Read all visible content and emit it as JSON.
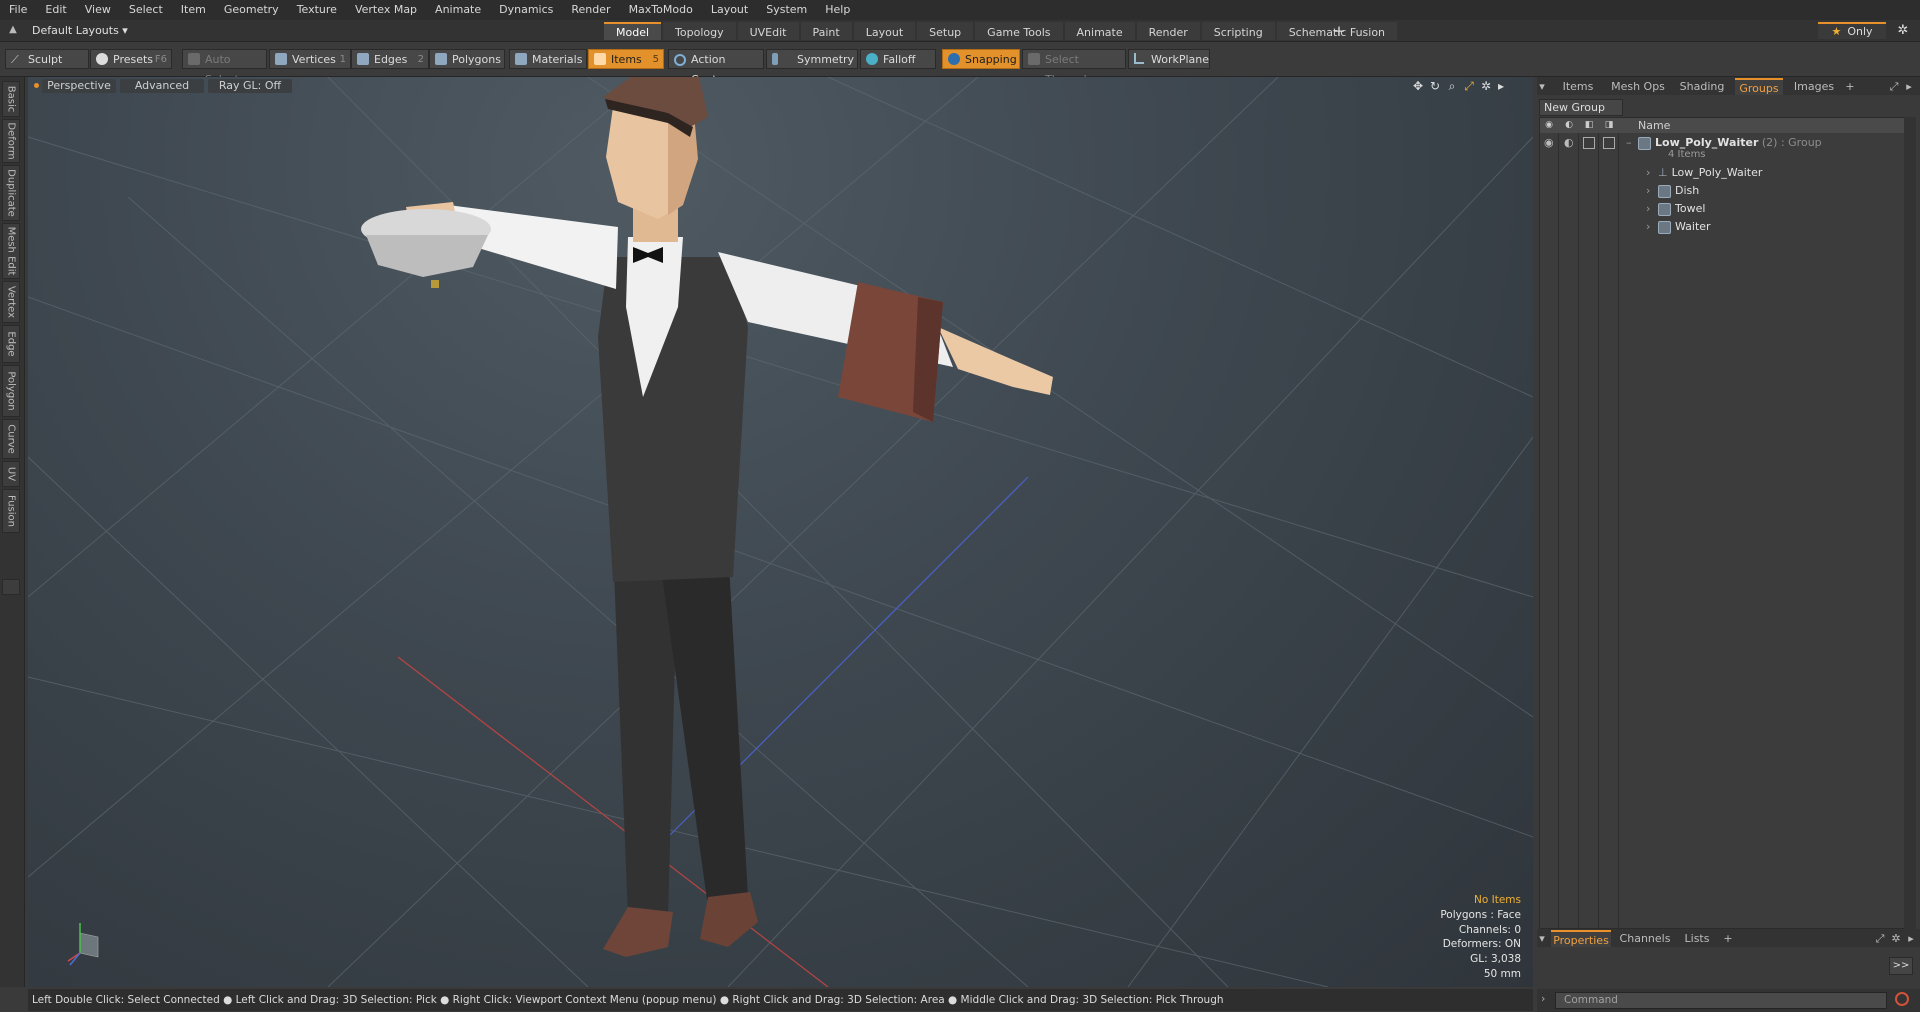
{
  "menu": [
    "File",
    "Edit",
    "View",
    "Select",
    "Item",
    "Geometry",
    "Texture",
    "Vertex Map",
    "Animate",
    "Dynamics",
    "Render",
    "MaxToModo",
    "Layout",
    "System",
    "Help"
  ],
  "layout_selector": "Default Layouts ▾",
  "mode_tabs": [
    "Model",
    "Topology",
    "UVEdit",
    "Paint",
    "Layout",
    "Setup",
    "Game Tools",
    "Animate",
    "Render",
    "Scripting",
    "Schematic Fusion"
  ],
  "active_mode_tab": "Model",
  "add_tab": "+",
  "only_label": "Only",
  "toolbar": {
    "sculpt": "Sculpt",
    "presets": "Presets",
    "presets_key": "F6",
    "auto_select": "Auto Select",
    "vertices": "Vertices",
    "vertices_key": "1",
    "edges": "Edges",
    "edges_key": "2",
    "polygons": "Polygons",
    "materials": "Materials",
    "items": "Items",
    "items_key": "5",
    "action_center": "Action Center",
    "symmetry": "Symmetry",
    "falloff": "Falloff",
    "snapping": "Snapping",
    "select_through": "Select Through",
    "workplane": "WorkPlane"
  },
  "left_tabs": [
    "Basic",
    "Deform",
    "Duplicate",
    "Mesh Edit",
    "Vertex",
    "Edge",
    "Polygon",
    "Curve",
    "UV",
    "Fusion"
  ],
  "viewport": {
    "view_type": "Perspective",
    "shading": "Advanced",
    "raygl": "Ray GL: Off"
  },
  "stats": [
    "No Items",
    "Polygons : Face",
    "Channels: 0",
    "Deformers: ON",
    "GL: 3,038",
    "50 mm"
  ],
  "status_bar": "Left Double Click: Select Connected ● Left Click and Drag: 3D Selection: Pick ● Right Click: Viewport Context Menu (popup menu) ● Right Click and Drag: 3D Selection: Area ● Middle Click and Drag: 3D Selection: Pick Through",
  "right_tabs": [
    "Items",
    "Mesh Ops",
    "Shading",
    "Groups",
    "Images",
    "+"
  ],
  "active_right_tab": "Groups",
  "new_group": "New Group",
  "tree": {
    "name_header": "Name",
    "group_name": "Low_Poly_Waiter",
    "group_suffix": "(2) : Group",
    "group_count": "4 Items",
    "children": [
      "Low_Poly_Waiter",
      "Dish",
      "Towel",
      "Waiter"
    ]
  },
  "bottom_tabs": [
    "Properties",
    "Channels",
    "Lists",
    "+"
  ],
  "active_bottom_tab": "Properties",
  "command_placeholder": "Command",
  "expand_label": ">>",
  "colors": {
    "accent": "#e8902a",
    "stats_highlight": "#f0b030",
    "skin": "#e8c4a0",
    "vest": "#3a3a3a",
    "shirt": "#f2f2f2",
    "towel": "#7a463a",
    "hair": "#6b4c3f"
  }
}
